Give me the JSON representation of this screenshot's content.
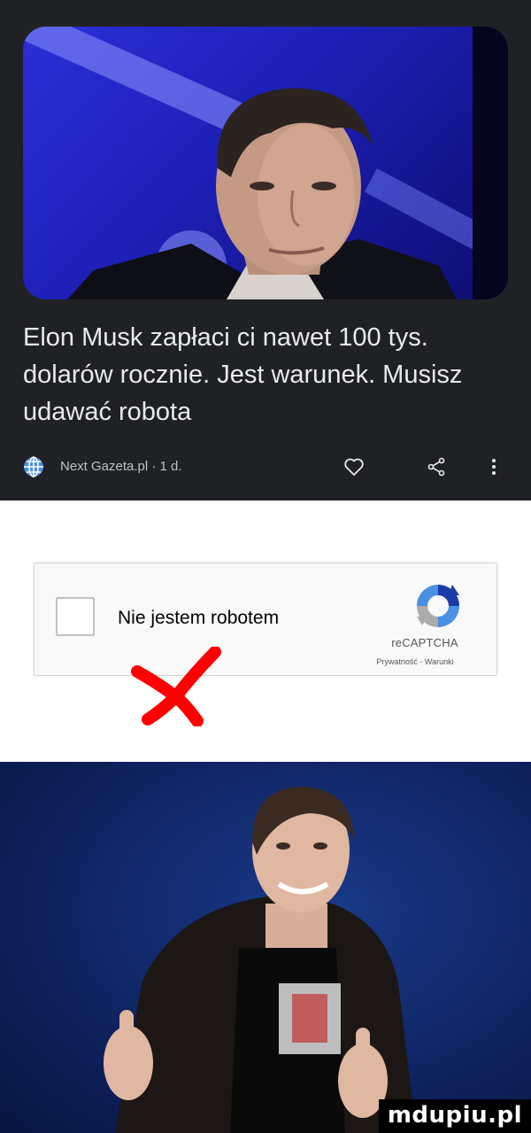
{
  "news": {
    "headline": "Elon Musk zapłaci ci nawet 100 tys. dolarów rocznie. Jest warunek. Musisz udawać robota",
    "source": "Next Gazeta.pl · 1 d.",
    "icons": [
      "globe-icon",
      "heart-icon",
      "share-icon",
      "more-vert-icon"
    ]
  },
  "captcha": {
    "label": "Nie jestem robotem",
    "brand": "reCAPTCHA",
    "privacy_link": "Prywatność",
    "separator": " - ",
    "terms_link": "Warunki",
    "checked": false
  },
  "overlay": {
    "icon": "red-x-mark-icon",
    "color": "#ff0000"
  },
  "watermark": {
    "text": "mdupiu.pl"
  },
  "colors": {
    "card_background": "#202124",
    "headline_text": "#e8eaed",
    "meta_text": "#bdc1c6",
    "captcha_blue": "#4a90e2"
  }
}
